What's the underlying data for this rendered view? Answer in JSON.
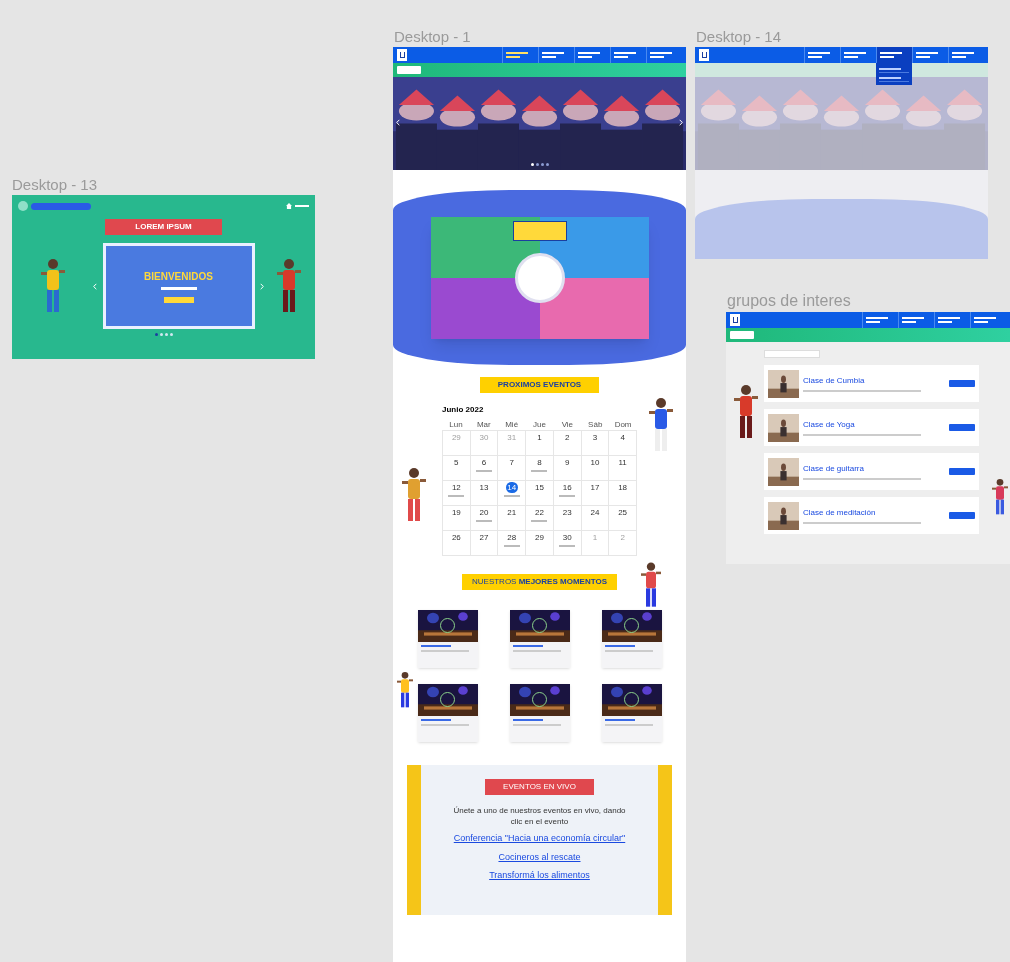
{
  "frame_13": {
    "title": "Desktop - 13",
    "banner": "LOREM IPSUM",
    "slide": {
      "heading": "BIENVENIDOS"
    },
    "dots": [
      {
        "selected": true
      },
      {
        "selected": false
      },
      {
        "selected": false
      },
      {
        "selected": false
      }
    ]
  },
  "frame_1": {
    "title": "Desktop - 1",
    "nav": [
      {
        "selected": true
      },
      {
        "selected": false
      },
      {
        "selected": false
      },
      {
        "selected": false
      },
      {
        "selected": false
      }
    ],
    "hero_dots": [
      {
        "selected": true
      },
      {
        "selected": false
      },
      {
        "selected": false
      },
      {
        "selected": false
      }
    ],
    "events_heading": "PROXIMOS EVENTOS",
    "calendar": {
      "month": "Junio 2022",
      "weekdays": [
        "Lun",
        "Mar",
        "Mié",
        "Jue",
        "Vie",
        "Sáb",
        "Dom"
      ],
      "weeks": [
        [
          {
            "day": "29",
            "muted": true,
            "event": false,
            "selected": false
          },
          {
            "day": "30",
            "muted": true,
            "event": false,
            "selected": false
          },
          {
            "day": "31",
            "muted": true,
            "event": false,
            "selected": false
          },
          {
            "day": "1",
            "muted": false,
            "event": false,
            "selected": false
          },
          {
            "day": "2",
            "muted": false,
            "event": false,
            "selected": false
          },
          {
            "day": "3",
            "muted": false,
            "event": false,
            "selected": false
          },
          {
            "day": "4",
            "muted": false,
            "event": false,
            "selected": false
          }
        ],
        [
          {
            "day": "5",
            "muted": false,
            "event": false,
            "selected": false
          },
          {
            "day": "6",
            "muted": false,
            "event": true,
            "selected": false
          },
          {
            "day": "7",
            "muted": false,
            "event": false,
            "selected": false
          },
          {
            "day": "8",
            "muted": false,
            "event": true,
            "selected": false
          },
          {
            "day": "9",
            "muted": false,
            "event": false,
            "selected": false
          },
          {
            "day": "10",
            "muted": false,
            "event": false,
            "selected": false
          },
          {
            "day": "11",
            "muted": false,
            "event": false,
            "selected": false
          }
        ],
        [
          {
            "day": "12",
            "muted": false,
            "event": true,
            "selected": false
          },
          {
            "day": "13",
            "muted": false,
            "event": false,
            "selected": false
          },
          {
            "day": "14",
            "muted": false,
            "event": true,
            "selected": true
          },
          {
            "day": "15",
            "muted": false,
            "event": false,
            "selected": false
          },
          {
            "day": "16",
            "muted": false,
            "event": true,
            "selected": false
          },
          {
            "day": "17",
            "muted": false,
            "event": false,
            "selected": false
          },
          {
            "day": "18",
            "muted": false,
            "event": false,
            "selected": false
          }
        ],
        [
          {
            "day": "19",
            "muted": false,
            "event": false,
            "selected": false
          },
          {
            "day": "20",
            "muted": false,
            "event": true,
            "selected": false
          },
          {
            "day": "21",
            "muted": false,
            "event": false,
            "selected": false
          },
          {
            "day": "22",
            "muted": false,
            "event": true,
            "selected": false
          },
          {
            "day": "23",
            "muted": false,
            "event": false,
            "selected": false
          },
          {
            "day": "24",
            "muted": false,
            "event": false,
            "selected": false
          },
          {
            "day": "25",
            "muted": false,
            "event": false,
            "selected": false
          }
        ],
        [
          {
            "day": "26",
            "muted": false,
            "event": false,
            "selected": false
          },
          {
            "day": "27",
            "muted": false,
            "event": false,
            "selected": false
          },
          {
            "day": "28",
            "muted": false,
            "event": true,
            "selected": false
          },
          {
            "day": "29",
            "muted": false,
            "event": false,
            "selected": false
          },
          {
            "day": "30",
            "muted": false,
            "event": true,
            "selected": false
          },
          {
            "day": "1",
            "muted": true,
            "event": false,
            "selected": false
          },
          {
            "day": "2",
            "muted": true,
            "event": false,
            "selected": false
          }
        ]
      ]
    },
    "moments_heading": {
      "plain": "NUESTROS",
      "bold": "MEJORES MOMENTOS"
    },
    "videos": [
      {
        "kind": "video"
      },
      {
        "kind": "video"
      },
      {
        "kind": "video"
      },
      {
        "kind": "video"
      },
      {
        "kind": "video"
      },
      {
        "kind": "video"
      }
    ],
    "live": {
      "heading": "EVENTOS EN VIVO",
      "text": "Únete a uno de nuestros eventos en vivo, dando clic en el evento",
      "links": [
        "Conferencia \"Hacia una economía circular\"",
        "Cocineros al rescate",
        "Transformá los alimentos"
      ]
    }
  },
  "frame_14": {
    "title": "Desktop - 14",
    "nav": [
      {
        "selected": false,
        "expanded": false
      },
      {
        "selected": false,
        "expanded": false
      },
      {
        "selected": false,
        "expanded": true
      },
      {
        "selected": false,
        "expanded": false
      },
      {
        "selected": false,
        "expanded": false
      }
    ],
    "dropdown": [
      {
        "kind": "item"
      },
      {
        "kind": "item"
      }
    ]
  },
  "frame_grupos": {
    "title": "grupos de interes",
    "nav": [
      {
        "selected": false
      },
      {
        "selected": false
      },
      {
        "selected": false
      },
      {
        "selected": false
      }
    ],
    "groups": [
      {
        "title": "Clase de Cumbia"
      },
      {
        "title": "Clase de Yoga"
      },
      {
        "title": "Clase de guitarra"
      },
      {
        "title": "Clase de meditación"
      }
    ]
  }
}
